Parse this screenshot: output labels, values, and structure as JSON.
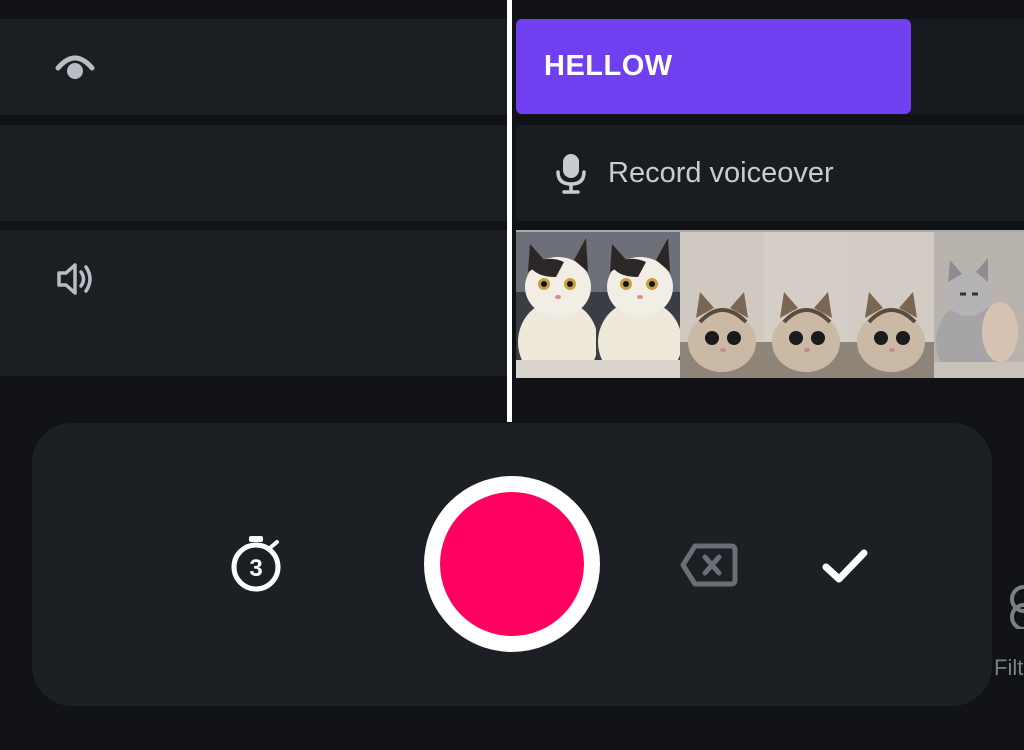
{
  "tracks": {
    "text_clip_label": "HELLOW",
    "voiceover_label": "Record voiceover"
  },
  "recorder": {
    "timer_seconds": "3"
  },
  "edge_toolbar": {
    "partial_label": "Filt"
  },
  "colors": {
    "background": "#101216",
    "track": "#1b1e23",
    "text_clip": "#7040f0",
    "record": "#ff0260",
    "panel": "#1c1f24"
  },
  "icons": [
    "eye-icon",
    "microphone-icon",
    "volume-icon",
    "timer-icon",
    "delete-icon",
    "checkmark-icon"
  ]
}
